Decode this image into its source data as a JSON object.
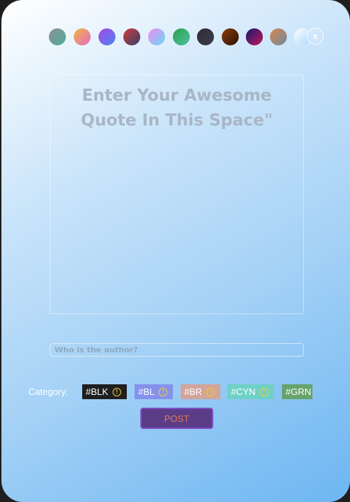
{
  "theme_swatches": [
    {
      "name": "swatch-gray-teal",
      "from": "#8a8f98",
      "to": "#4fae9a"
    },
    {
      "name": "swatch-orange-pink",
      "from": "#f3b23e",
      "to": "#e46bc7"
    },
    {
      "name": "swatch-purple-blue",
      "from": "#a648e8",
      "to": "#4f83f0"
    },
    {
      "name": "swatch-crimson-navy",
      "from": "#cf3b3b",
      "to": "#34406b"
    },
    {
      "name": "swatch-pink-cyan",
      "from": "#f28cf0",
      "to": "#66d8f7"
    },
    {
      "name": "swatch-green",
      "from": "#2f9c4e",
      "to": "#4cc4a0"
    },
    {
      "name": "swatch-charcoal",
      "from": "#2d2d38",
      "to": "#3b3c49"
    },
    {
      "name": "swatch-brown",
      "from": "#8a3c0c",
      "to": "#2b1304"
    },
    {
      "name": "swatch-navy-magenta",
      "from": "#16186e",
      "to": "#c2185b"
    },
    {
      "name": "swatch-rust-slate",
      "from": "#d6864d",
      "to": "#6f8aa4"
    },
    {
      "name": "swatch-frost",
      "from": "#ffffff",
      "to": "#a9d7ff"
    }
  ],
  "close_label": "x",
  "quote": {
    "text": "Enter Your Awesome Quote In This Space\""
  },
  "author": {
    "placeholder": "Who is the author?"
  },
  "category": {
    "label": "Category:",
    "tags": [
      {
        "label": "#BLK",
        "color": "#1f1f1f",
        "info": true
      },
      {
        "label": "#BL",
        "color": "#8591ea",
        "info": true
      },
      {
        "label": "#BR",
        "color": "#d2a49a",
        "info": true
      },
      {
        "label": "#CYN",
        "color": "#6fd1c6",
        "info": true
      },
      {
        "label": "#GRN",
        "color": "#67a36b",
        "info": false
      }
    ]
  },
  "post_button": {
    "label": "POST"
  },
  "colors": {
    "post_bg": "#5a3d86",
    "post_border": "#7e4fc7",
    "post_text": "#e0765c",
    "info_icon": "#f2cd3c"
  }
}
